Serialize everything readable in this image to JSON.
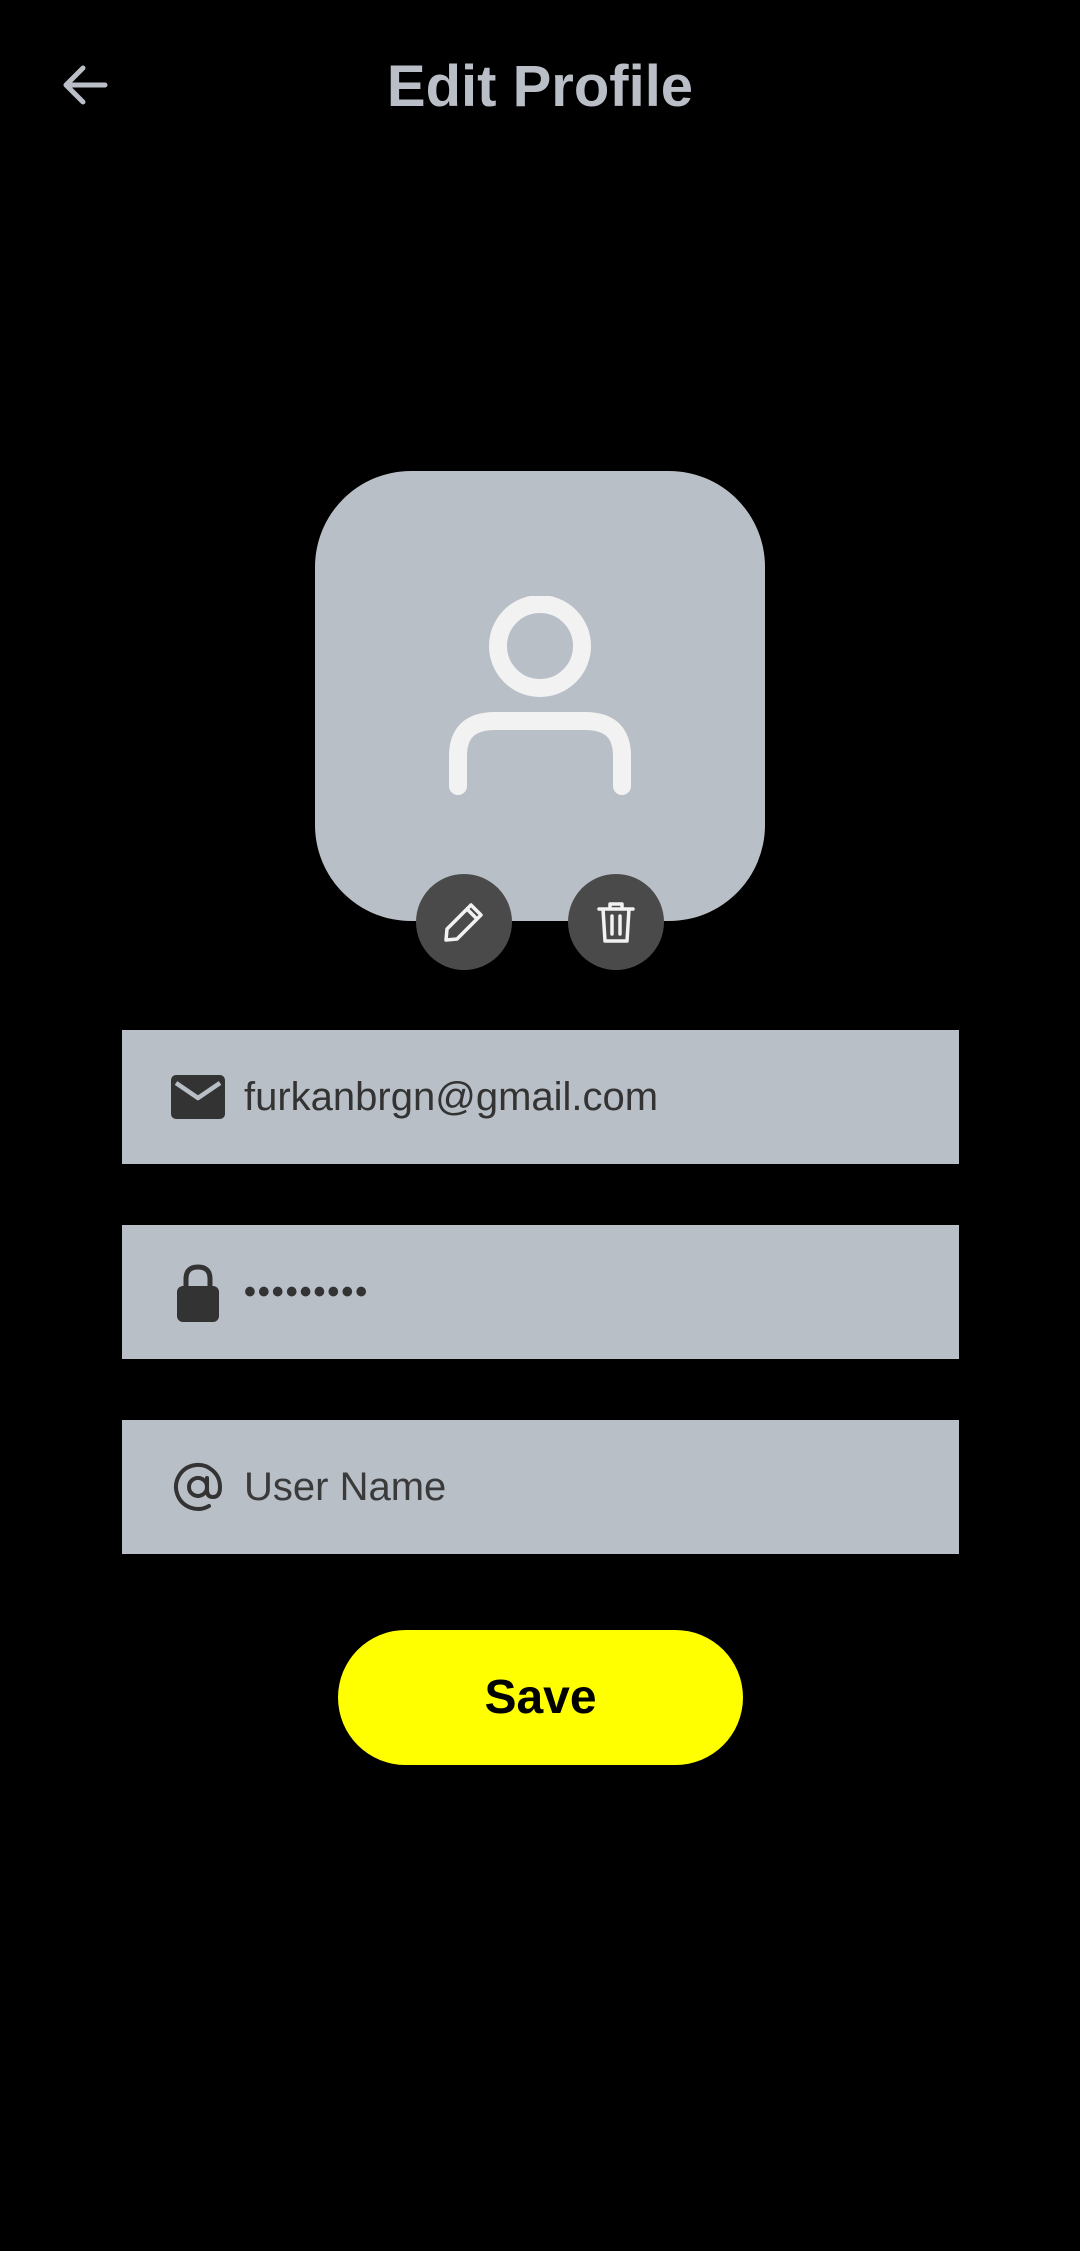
{
  "header": {
    "title": "Edit Profile",
    "back_icon": "arrow-left-icon"
  },
  "avatar": {
    "icon": "user-icon",
    "edit_icon": "pencil-icon",
    "delete_icon": "trash-icon"
  },
  "form": {
    "email": {
      "icon": "envelope-icon",
      "value": "furkanbrgn@gmail.com"
    },
    "password": {
      "icon": "lock-icon",
      "value": "•••••••••"
    },
    "username": {
      "icon": "at-icon",
      "placeholder": "User Name",
      "value": ""
    }
  },
  "actions": {
    "save_label": "Save"
  },
  "colors": {
    "background": "#000000",
    "title": "#babfc7",
    "field_bg": "#b9bfc7",
    "field_text": "#333333",
    "accent": "#ffff00",
    "action_circle": "#4a4a4a",
    "avatar_glyph": "#f2f2f2"
  }
}
